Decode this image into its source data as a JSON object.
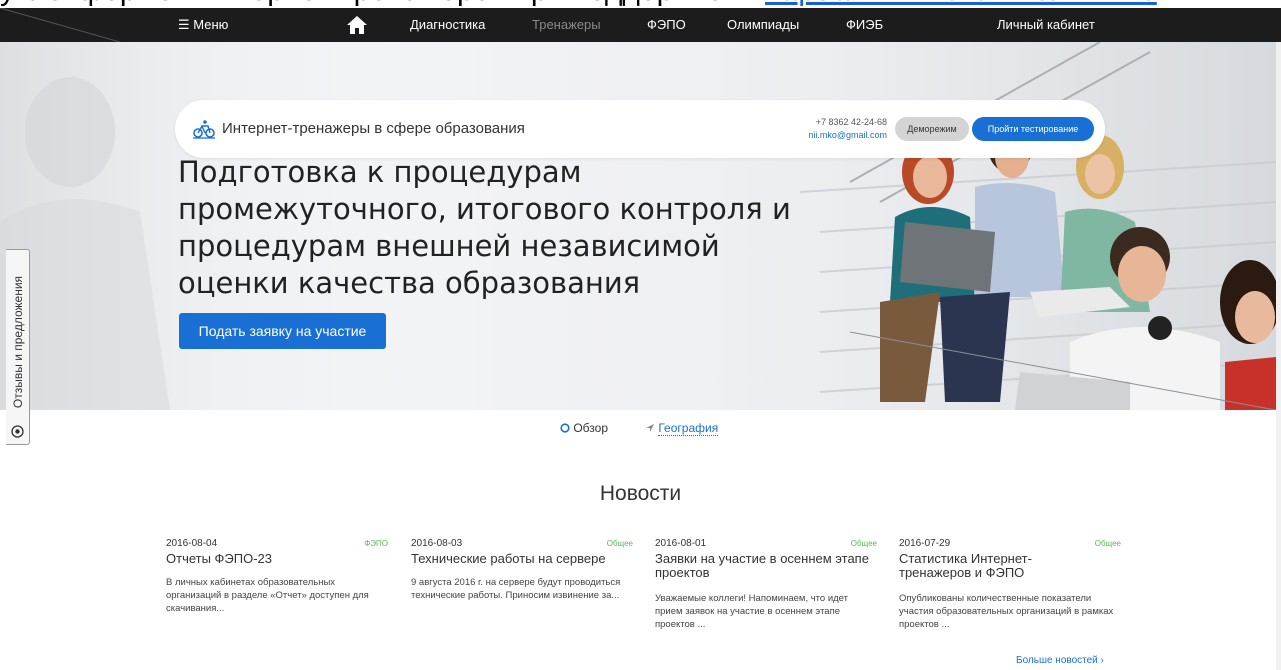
{
  "top_strip": {
    "text": "уплатформой Интернет-тренажеров при поддержке",
    "link": "https://www.i-exam.ru/nii-mko"
  },
  "nav": {
    "menu": "☰ Меню",
    "diagnostics": "Диагностика",
    "trainers": "Тренажеры",
    "fepo": "ФЭПО",
    "olympiads": "Олимпиады",
    "fieb": "ФИЭБ",
    "cabinet": "Личный кабинет"
  },
  "infobar": {
    "title": "Интернет-тренажеры в сфере образования",
    "phone": "+7 8362 42-24-68",
    "email": "nii.mko@gmail.com",
    "demo": "Деморежим",
    "test": "Пройти тестирование"
  },
  "hero": {
    "headline": "Подготовка к процедурам промежуточного, итогового контроля и процедурам внешней независимой оценки качества образования",
    "apply": "Подать заявку на участие"
  },
  "feedback": "Отзывы и предложения",
  "tabs": {
    "overview": "Обзор",
    "geography": "География"
  },
  "news": {
    "heading": "Новости",
    "items": [
      {
        "date": "2016-08-04",
        "category": "ФЭПО",
        "title": "Отчеты ФЭПО-23",
        "text": "В личных кабинетах образовательных организаций в разделе «Отчет» доступен для скачивания..."
      },
      {
        "date": "2016-08-03",
        "category": "Общее",
        "title": "Технические работы на сервере",
        "text": "9 августа 2016 г. на сервере будут проводиться технические работы. Приносим извинение за..."
      },
      {
        "date": "2016-08-01",
        "category": "Общее",
        "title": "Заявки на участие в осеннем этапе проектов",
        "text": "Уважаемые коллеги! Напоминаем, что идет прием заявок на участие в осеннем этапе проектов ..."
      },
      {
        "date": "2016-07-29",
        "category": "Общее",
        "title": "Статистика Интернет-тренажеров и ФЭПО",
        "text": "Опубликованы количественные показатели участия образовательных организаций в рамках проектов ..."
      }
    ],
    "more": "Больше новостей ›"
  },
  "colors": {
    "navbar": "#1c1c1c",
    "accent": "#1a6fd4",
    "category": "#5cb85c"
  },
  "icons": [
    "home-icon",
    "bicycle-logo-icon",
    "circle-icon",
    "location-arrow-icon",
    "comment-icon"
  ]
}
